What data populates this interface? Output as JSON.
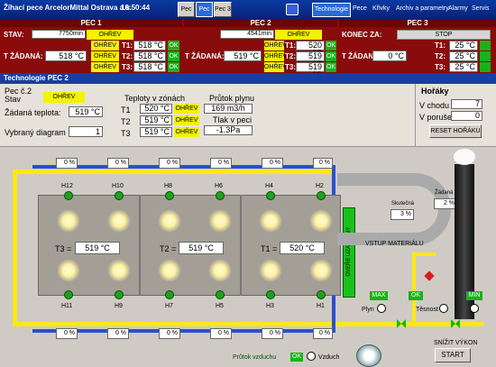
{
  "titlebar": {
    "title": "Žíhací pece ArcelorMittal Ostrava a.s.",
    "time": "10:50:44",
    "tabs": [
      "Pec 1",
      "Pec 2",
      "Pec 3"
    ],
    "menu": [
      "Technologie",
      "Pece",
      "Křivky",
      "Archiv a parametry",
      "Alarmy",
      "Servis"
    ]
  },
  "pec1": {
    "title": "PEC 1",
    "stav_label": "STAV:",
    "time": "7750min",
    "state": "OHŘEV",
    "tzad_label": "T ŽÁDANÁ:",
    "tzad": "518 °C",
    "zones": [
      {
        "label": "T1:",
        "value": "518 °C",
        "state": "OHŘEV",
        "ok": "OK"
      },
      {
        "label": "T2:",
        "value": "518 °C",
        "state": "OHŘEV",
        "ok": "OK"
      },
      {
        "label": "T3:",
        "value": "518 °C",
        "state": "OHŘEV",
        "ok": "OK"
      }
    ]
  },
  "pec2": {
    "title": "PEC 2",
    "time": "4541min",
    "state": "OHŘEV",
    "tzad_label": "T ŽÁDANÁ:",
    "tzad": "519 °C",
    "zones": [
      {
        "label": "T1:",
        "value": "520 °C",
        "state": "OHŘEV",
        "ok": "OK"
      },
      {
        "label": "T2:",
        "value": "519 °C",
        "state": "OHŘEV",
        "ok": "OK"
      },
      {
        "label": "T3:",
        "value": "519 °C",
        "state": "OHŘEV",
        "ok": "OK"
      }
    ]
  },
  "pec3": {
    "title": "PEC 3",
    "konec_label": "KONEC ZA:",
    "state": "STOP",
    "tzad_label": "T ŽÁDANÁ:",
    "tzad": "0 °C",
    "zones": [
      {
        "label": "T1:",
        "value": "25 °C"
      },
      {
        "label": "T2:",
        "value": "25 °C"
      },
      {
        "label": "T3:",
        "value": "25 °C"
      }
    ]
  },
  "section_title": "Technologie PEC 2",
  "info": {
    "pec_label": "Pec č.2",
    "stav_label": "Stav",
    "stav": "OHŘEV",
    "zadana_label": "Žádaná teplota:",
    "zadana": "519 °C",
    "diagram_label": "Vybraný diagram",
    "diagram": "1"
  },
  "zones": {
    "title": "Teploty v zónách",
    "rows": [
      {
        "label": "T1",
        "value": "520 °C",
        "state": "OHŘEV"
      },
      {
        "label": "T2",
        "value": "519 °C",
        "state": "OHŘEV"
      },
      {
        "label": "T3",
        "value": "519 °C",
        "state": "OHŘEV"
      }
    ]
  },
  "gas": {
    "flow_label": "Průtok plynu",
    "flow": "169 m3/h",
    "pressure_label": "Tlak v peci",
    "pressure": "-1.3Pa"
  },
  "horaky": {
    "title": "Hořáky",
    "chodu_label": "V chodu :",
    "chodu": "7",
    "poruse_label": "V poruše :",
    "poruse": "0",
    "reset": "RESET HOŘÁKU"
  },
  "diagram": {
    "top_pct": [
      "0 %",
      "0 %",
      "0 %",
      "0 %",
      "0 %",
      "0 %"
    ],
    "bottom_pct": [
      "0 %",
      "0 %",
      "0 %",
      "0 %",
      "0 %",
      "0 %"
    ],
    "burners_top": [
      "H12",
      "H10",
      "H8",
      "H6",
      "H4",
      "H2"
    ],
    "burners_bottom": [
      "H11",
      "H9",
      "H7",
      "H5",
      "H3",
      "H1"
    ],
    "t3": "T3 =",
    "t3v": "519 °C",
    "t2": "T2 =",
    "t2v": "519 °C",
    "t1": "T1 =",
    "t1v": "520 °C",
    "door": "DVEŘE UZAVŘENY",
    "vstup": "VSTUP MATERIÁLU",
    "skutecna_label": "Skutečná",
    "skutecna": "3 %",
    "zadana_label": "Žádaná",
    "zadana": "2 %",
    "max": "MAX",
    "ok": "OK",
    "min": "MIN",
    "plyn": "Plyn",
    "tesnost": "Těsnost",
    "snizit": "SNÍŽIT VÝKON",
    "start": "START",
    "prutok_label": "Průtok vzduchu",
    "prutok_ok": "OK",
    "vzduch": "Vzduch"
  }
}
